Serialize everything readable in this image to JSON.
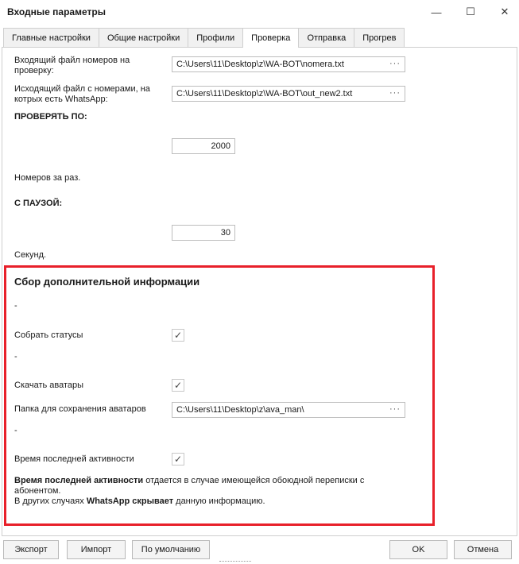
{
  "window": {
    "title": "Входные параметры",
    "minimize_icon": "minimize-icon",
    "maximize_icon": "maximize-icon",
    "close_icon": "close-icon"
  },
  "tabs": [
    {
      "label": "Главные настройки"
    },
    {
      "label": "Общие настройки"
    },
    {
      "label": "Профили"
    },
    {
      "label": "Проверка",
      "active": true
    },
    {
      "label": "Отправка"
    },
    {
      "label": "Прогрев"
    }
  ],
  "form": {
    "input_file_label": "Входящий файл номеров на проверку:",
    "input_file_value": "C:\\Users\\11\\Desktop\\z\\WA-BOT\\nomera.txt",
    "output_file_label": "Исходящий файл с номерами, на котрых есть WhatsApp:",
    "output_file_value": "C:\\Users\\11\\Desktop\\z\\WA-BOT\\out_new2.txt",
    "check_by_heading": "ПРОВЕРЯТЬ ПО:",
    "check_by_value": "2000",
    "check_by_hint": "Номеров за раз.",
    "pause_heading": "С ПАУЗОЙ:",
    "pause_value": "30",
    "pause_hint": "Секунд.",
    "browse_label": "···"
  },
  "extra": {
    "title": "Сбор дополнительной информации",
    "dash": "-",
    "collect_status_label": "Собрать статусы",
    "collect_status_checked": true,
    "download_avatars_label": "Скачать аватары",
    "download_avatars_checked": true,
    "avatars_folder_label": "Папка для сохранения аватаров",
    "avatars_folder_value": "C:\\Users\\11\\Desktop\\z\\ava_man\\",
    "last_activity_label": "Время последней активности",
    "last_activity_checked": true,
    "check_mark": "✓",
    "note_bold1": "Время последней активности",
    "note_part1": " отдается в случае имеющейся обоюдной переписки с абонентом.",
    "note_part2a": "В других случаях ",
    "note_bold2": "WhatsApp скрывает",
    "note_part2b": " данную информацию."
  },
  "buttons": {
    "export": "Экспорт",
    "import": "Импорт",
    "defaults": "По умолчанию",
    "ok": "OK",
    "cancel": "Отмена"
  },
  "colors": {
    "highlight_border": "#e8202a"
  }
}
